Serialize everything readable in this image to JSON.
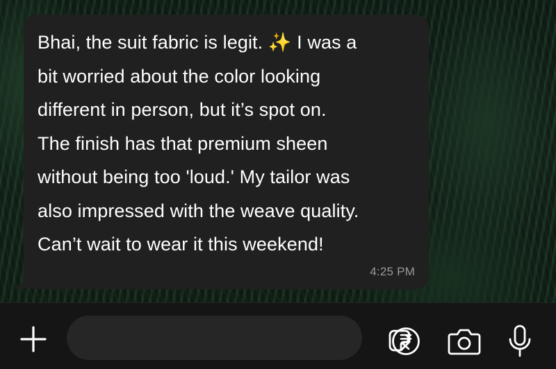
{
  "conversation": {
    "message": {
      "text": "Bhai, the suit fabric is legit. ✨ I was a\nbit worried about the color looking\ndifferent in person, but it’s spot on.\nThe finish has that premium sheen\nwithout being too 'loud.' My tailor was\nalso impressed with the weave quality.\nCan’t wait to wear it this weekend!",
      "time": "4:25 PM"
    }
  },
  "composer": {
    "input_value": "",
    "icons": [
      "plus-icon",
      "sticker-icon",
      "rupee-payment-icon",
      "camera-icon",
      "microphone-icon"
    ]
  },
  "colors": {
    "bubble": "#202020",
    "composer_bg": "#151515",
    "input_bg": "#262626",
    "timestamp": "#9a9a9a",
    "icon": "#ffffff"
  }
}
